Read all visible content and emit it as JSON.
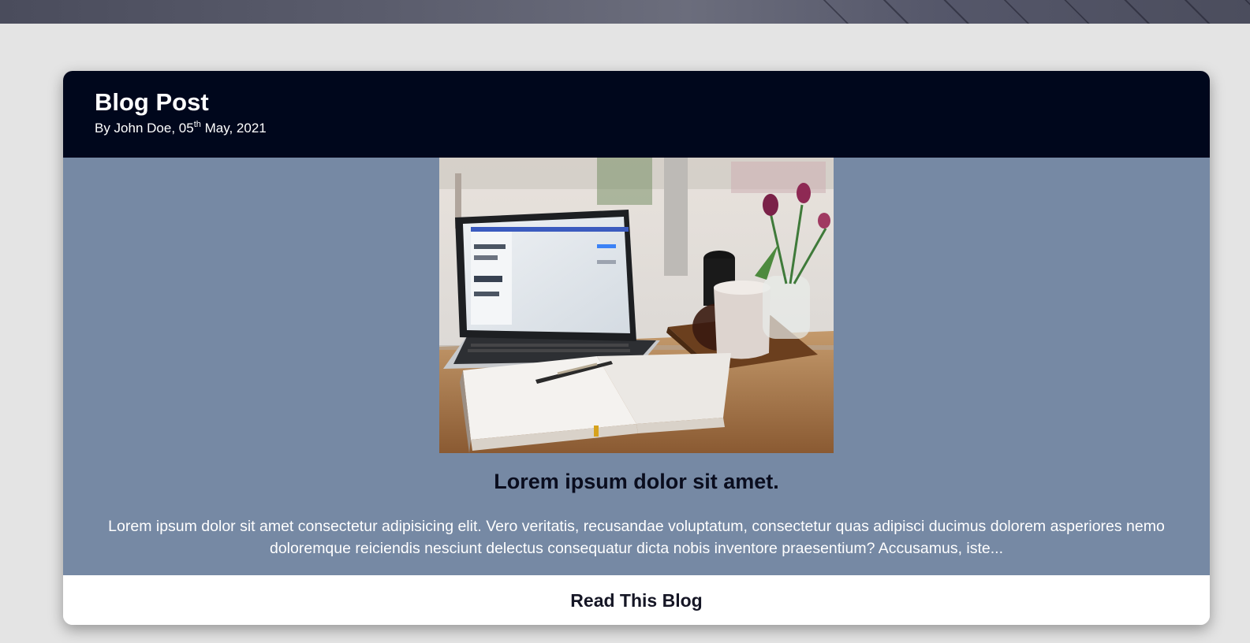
{
  "page": {
    "background": "#e4e4e4"
  },
  "card": {
    "header": {
      "title": "Blog Post",
      "byline_prefix": "By John Doe, 05",
      "byline_sup": "th",
      "byline_suffix": " May, 2021",
      "background": "#00071c"
    },
    "body": {
      "image_subject": "laptop-notebook-desk-photo",
      "heading": "Lorem ipsum dolor sit amet.",
      "excerpt": "Lorem ipsum dolor sit amet consectetur adipisicing elit. Vero veritatis, recusandae voluptatum, consectetur quas adipisci ducimus dolorem asperiores nemo doloremque reiciendis nesciunt delectus consequatur dicta nobis inventore praesentium? Accusamus, iste...",
      "background": "#7689a4"
    },
    "footer": {
      "button_label": "Read This Blog"
    }
  }
}
